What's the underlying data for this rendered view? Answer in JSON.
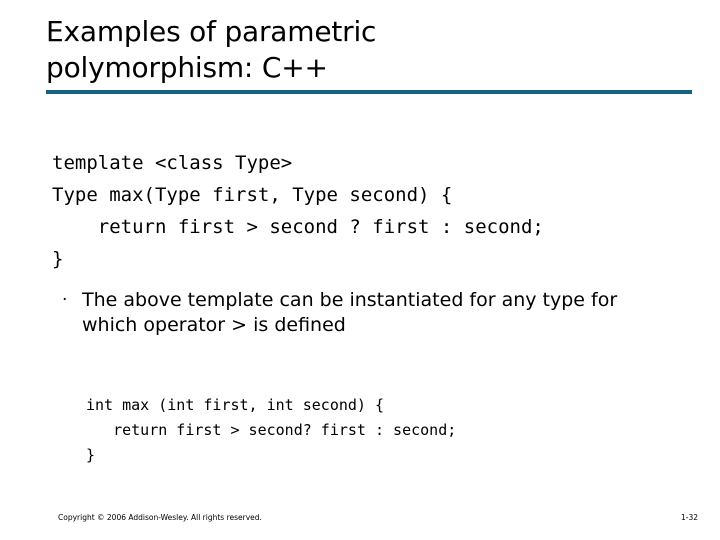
{
  "slide": {
    "title": {
      "line1": "Examples of parametric",
      "line2": "polymorphism: C++"
    },
    "rule_color": "#176087",
    "code_block_1": "template <class Type>\nType max(Type first, Type second) {\n    return first > second ? first : second;\n}",
    "bullet": {
      "marker": "·",
      "text": "The above template can be instantiated for any type for which operator > is defined"
    },
    "code_block_2": "int max (int first, int second) {\n   return first > second? first : second;\n}",
    "footer": {
      "copyright": "Copyright © 2006 Addison-Wesley. All rights reserved.",
      "page_number": "1-32"
    }
  }
}
